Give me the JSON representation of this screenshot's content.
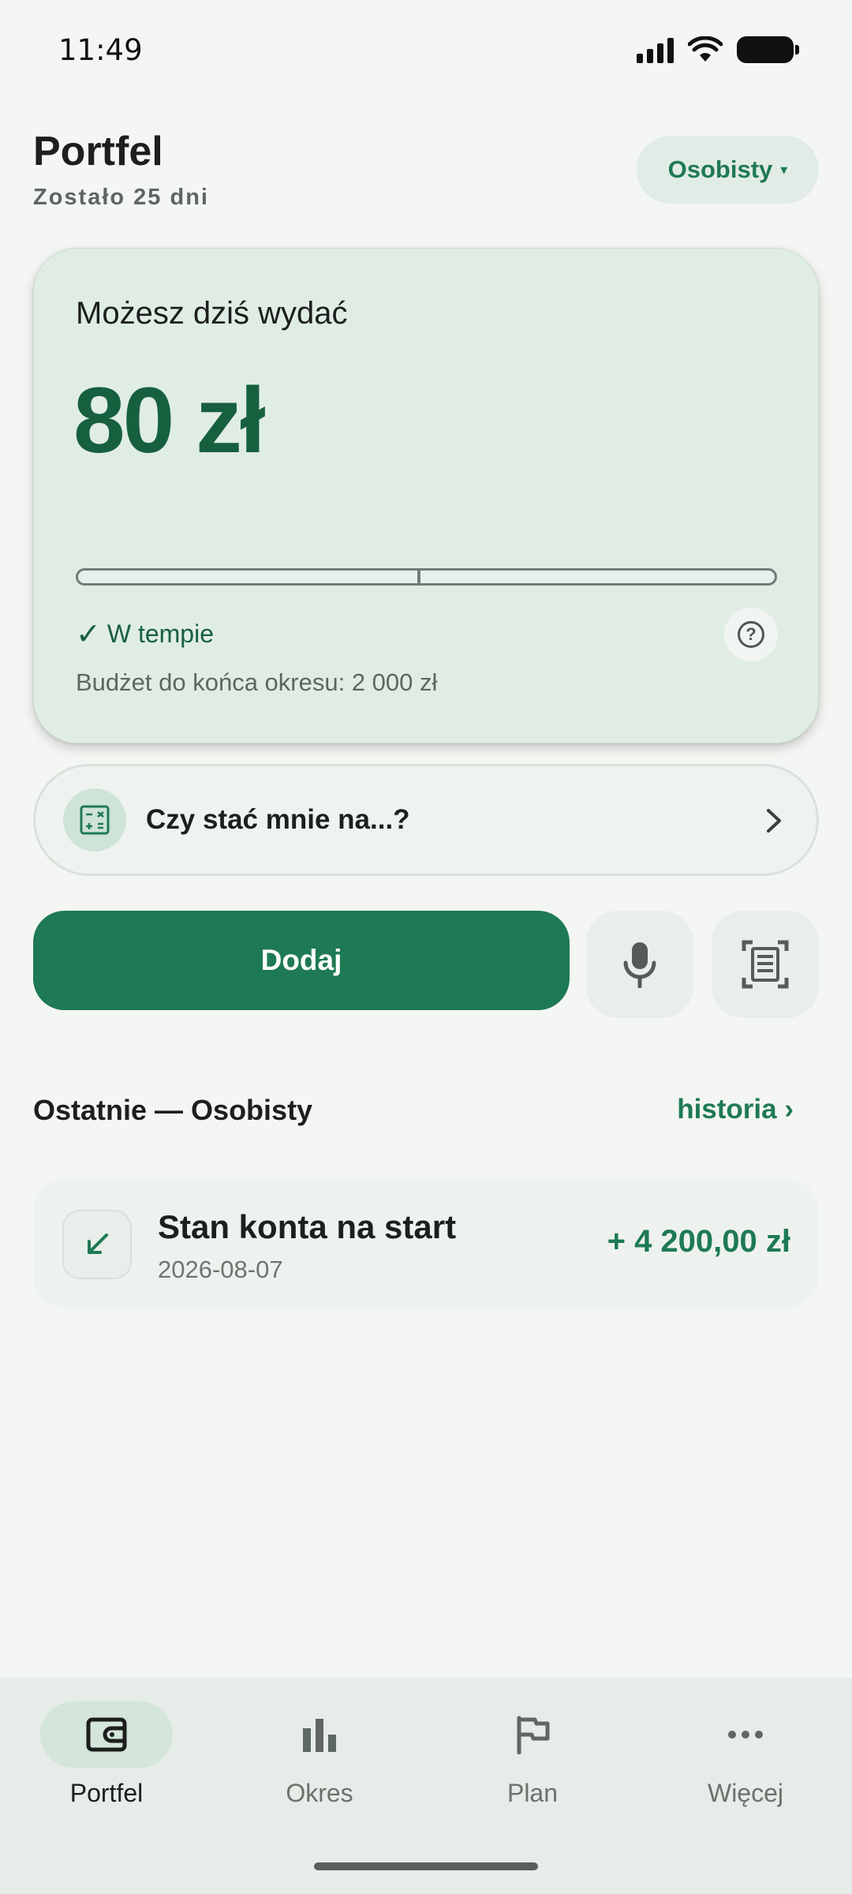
{
  "status_bar": {
    "time": "11:49"
  },
  "header": {
    "title": "Portfel",
    "subtitle": "Zostało 25 dni",
    "account_selector": "Osobisty",
    "account_caret": "▾"
  },
  "budget_card": {
    "label": "Możesz dziś wydać",
    "amount": "80 zł",
    "progress": 0.0,
    "pace_check": "✓",
    "pace_status": "W tempie",
    "budget_line": "Budżet do końca okresu: 2 000 zł"
  },
  "afford": {
    "label": "Czy stać mnie na...?"
  },
  "actions": {
    "add_label": "Dodaj"
  },
  "recent": {
    "title": "Ostatnie — Osobisty",
    "history_link": "historia ›",
    "transactions": [
      {
        "title": "Stan konta na start",
        "date": "2026-08-07",
        "amount": "+ 4 200,00 zł"
      }
    ]
  },
  "nav": {
    "items": [
      {
        "label": "Portfel",
        "icon": "wallet-icon",
        "active": true
      },
      {
        "label": "Okres",
        "icon": "bar-chart-icon",
        "active": false
      },
      {
        "label": "Plan",
        "icon": "flag-icon",
        "active": false
      },
      {
        "label": "Więcej",
        "icon": "more-dots-icon",
        "active": false
      }
    ]
  },
  "colors": {
    "accent": "#1e7a54",
    "amount": "#17603f",
    "card_bg": "#e0ede5",
    "page_bg": "#f4f6f3"
  }
}
